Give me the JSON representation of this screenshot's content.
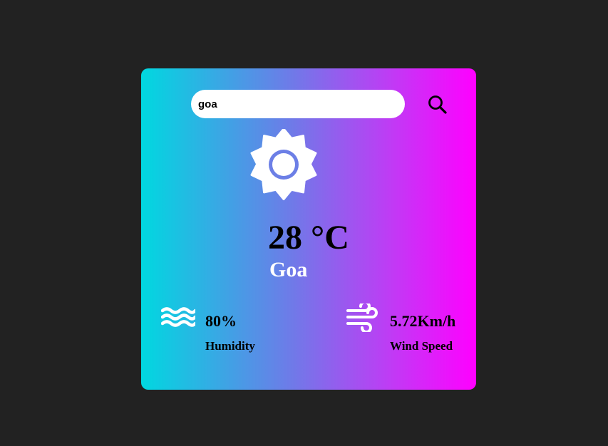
{
  "search": {
    "value": "goa",
    "icon": "search-icon"
  },
  "weather": {
    "icon": "sun-icon",
    "temperature": "28 °C",
    "city": "Goa"
  },
  "details": {
    "humidity": {
      "icon": "waves-icon",
      "value": "80%",
      "label": "Humidity"
    },
    "wind": {
      "icon": "wind-icon",
      "value": "5.72Km/h",
      "label": "Wind Speed"
    }
  },
  "colors": {
    "page_background": "#222222",
    "gradient_start": "#00d8e0",
    "gradient_end": "#ff00ff",
    "text_primary": "#000000",
    "text_city": "#ffffff"
  }
}
